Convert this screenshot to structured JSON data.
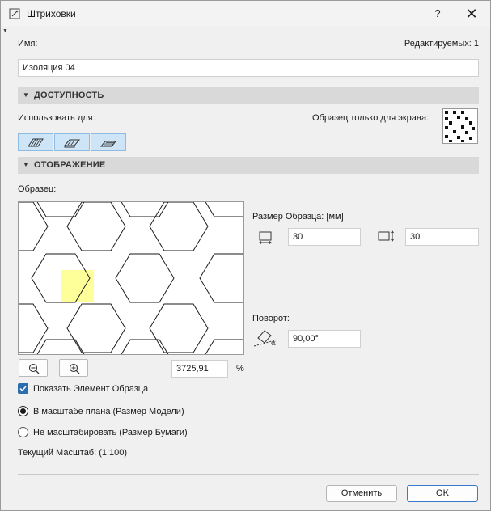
{
  "window": {
    "title": "Штриховки",
    "help_label": "?",
    "close_label": "✕"
  },
  "name": {
    "label": "Имя:",
    "editable_count": "Редактируемых: 1",
    "value": "Изоляция 04"
  },
  "availability": {
    "header": "ДОСТУПНОСТЬ",
    "use_for_label": "Использовать для:",
    "screen_only_label": "Образец только для экрана:",
    "use_for_buttons": [
      {
        "icon": "fill-cut-icon",
        "selected": true
      },
      {
        "icon": "fill-cover-icon",
        "selected": true
      },
      {
        "icon": "fill-drafting-icon",
        "selected": true
      }
    ]
  },
  "display": {
    "header": "ОТОБРАЖЕНИЕ",
    "sample_label": "Образец:",
    "pattern_size_label": "Размер Образца: [мм]",
    "width_value": "30",
    "height_value": "30",
    "rotation_label": "Поворот:",
    "rotation_value": "90,00°",
    "zoom_value": "3725,91",
    "zoom_unit": "%",
    "show_element_label": "Показать Элемент Образца",
    "show_element_checked": true,
    "scale_options": [
      {
        "label": "В масштабе плана (Размер Модели)",
        "selected": true
      },
      {
        "label": "Не масштабировать (Размер Бумаги)",
        "selected": false
      }
    ],
    "current_scale": "Текущий Масштаб: (1:100)"
  },
  "colors": {
    "selected_button_bg": "#cde5f7",
    "pattern_element_fill": "#ffff99",
    "accent": "#2a6db0"
  },
  "footer": {
    "cancel_label": "Отменить",
    "ok_label": "OK"
  }
}
